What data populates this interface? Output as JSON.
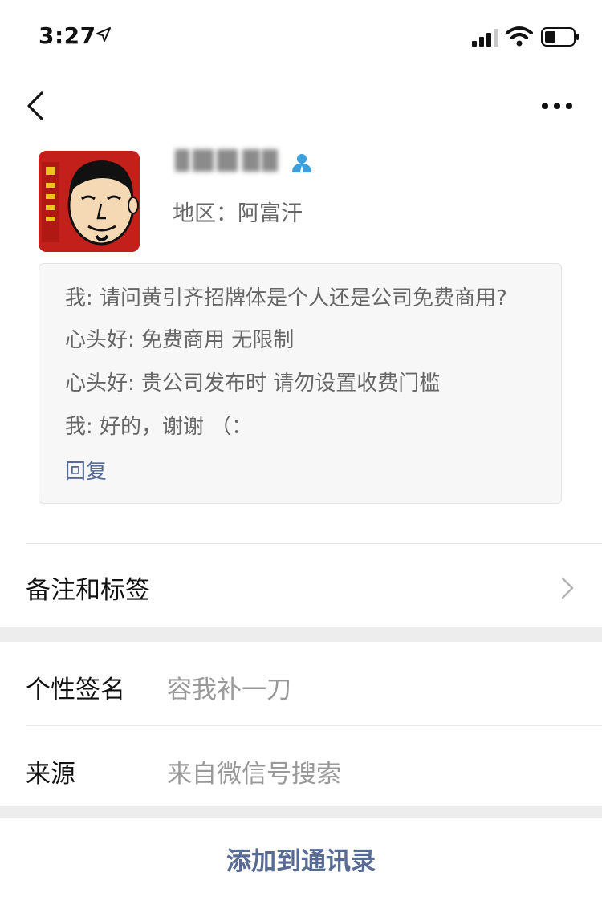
{
  "status_bar": {
    "time": "3:27",
    "icons": [
      "location-arrow-icon",
      "cellular-signal-icon",
      "wifi-icon",
      "battery-icon"
    ]
  },
  "nav": {
    "icons": [
      "back-chevron-icon",
      "more-dots-icon"
    ]
  },
  "profile": {
    "region": "地区：阿富汗",
    "badge_color": "#3a9fdf"
  },
  "chat": {
    "messages": [
      "我: 请问黄引齐招牌体是个人还是公司免费商用?",
      "心头好: 免费商用 无限制",
      "心头好: 贵公司发布时 请勿设置收费门槛",
      "我: 好的，谢谢 （："
    ],
    "reply_label": "回复"
  },
  "rows": {
    "remarks_label": "备注和标签",
    "signature_label": "个性签名",
    "signature_value": "容我补一刀",
    "source_label": "来源",
    "source_value": "来自微信号搜索"
  },
  "actions": {
    "add_contact_label": "添加到通讯录"
  },
  "colors": {
    "link": "#576b95",
    "secondary_text": "#666666",
    "placeholder_text": "#999999",
    "section_gap": "#ededed",
    "chat_bg": "#f7f7f7",
    "avatar_red": "#c3201b"
  }
}
